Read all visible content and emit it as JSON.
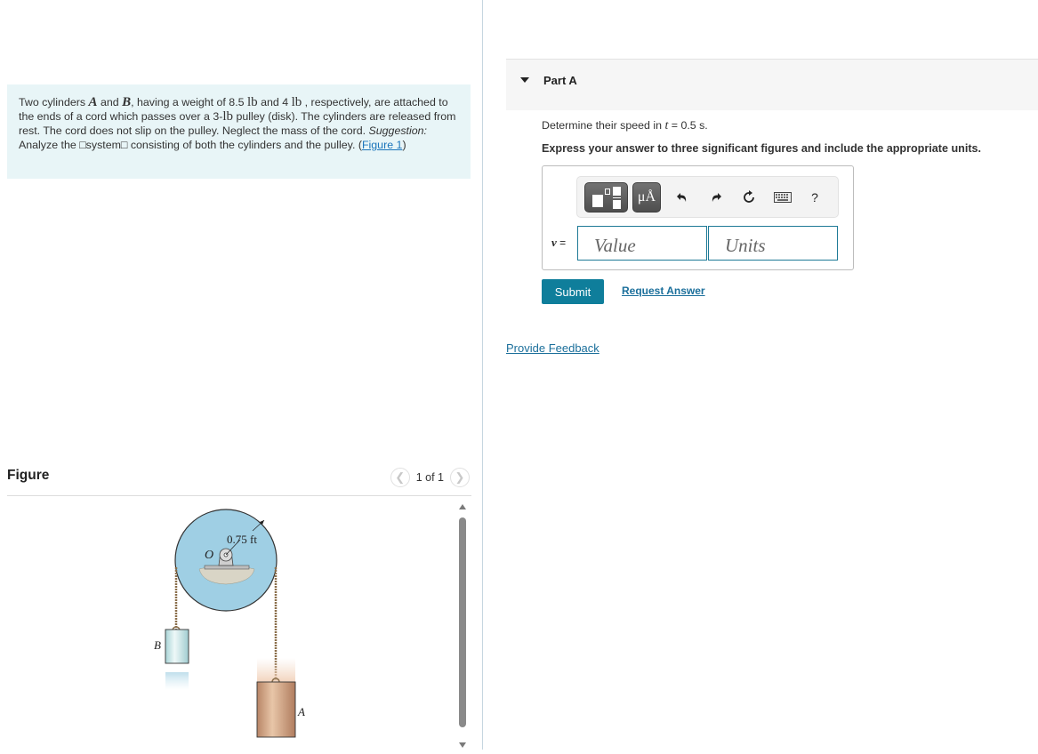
{
  "problem": {
    "text_1": "Two cylinders ",
    "var_a": "A",
    "text_2": " and ",
    "var_b": "B",
    "text_3": ", having a weight of 8.5 ",
    "unit_lb": "lb",
    "text_4": " and 4 ",
    "text_5": " , respectively, are attached to the ends of a cord which passes over a 3-",
    "text_6": " pulley (disk). The cylinders are released from rest. The cord does not slip on the pulley. Neglect the mass of the cord. ",
    "suggestion_label": "Suggestion:",
    "text_7": " Analyze the □system□ consisting of both the cylinders and the pulley. (",
    "figure_link": "Figure 1",
    "text_8": ")"
  },
  "figure": {
    "title": "Figure",
    "page_indicator": "1 of 1",
    "prev_icon": "chevron-left-icon",
    "next_icon": "chevron-right-icon",
    "radius_label": "0.75 ft",
    "pivot_label": "O",
    "cylinder_a_label": "A",
    "cylinder_b_label": "B",
    "colors": {
      "pulley": "#9fcfe4",
      "cylinder_a": "#c89a7a",
      "cylinder_b": "#cfe8ea"
    }
  },
  "part": {
    "title": "Part A",
    "question_prefix": "Determine their speed in ",
    "question_var": "t",
    "question_suffix": " = 0.5 s.",
    "instruction": "Express your answer to three significant figures and include the appropriate units."
  },
  "answer": {
    "toolbar": {
      "template_icon": "template-icon",
      "units_label": "μÅ",
      "undo_icon": "undo-icon",
      "redo_icon": "redo-icon",
      "reset_icon": "reset-icon",
      "keyboard_icon": "keyboard-icon",
      "help_label": "?"
    },
    "variable": "v",
    "equals": " =",
    "value_placeholder": "Value",
    "units_placeholder": "Units",
    "value": "",
    "units": ""
  },
  "actions": {
    "submit_label": "Submit",
    "request_answer_label": "Request Answer",
    "feedback_label": "Provide Feedback"
  },
  "colors": {
    "accent": "#0f7e9b",
    "link": "#1b6f9b",
    "problem_bg": "#e8f5f7"
  }
}
